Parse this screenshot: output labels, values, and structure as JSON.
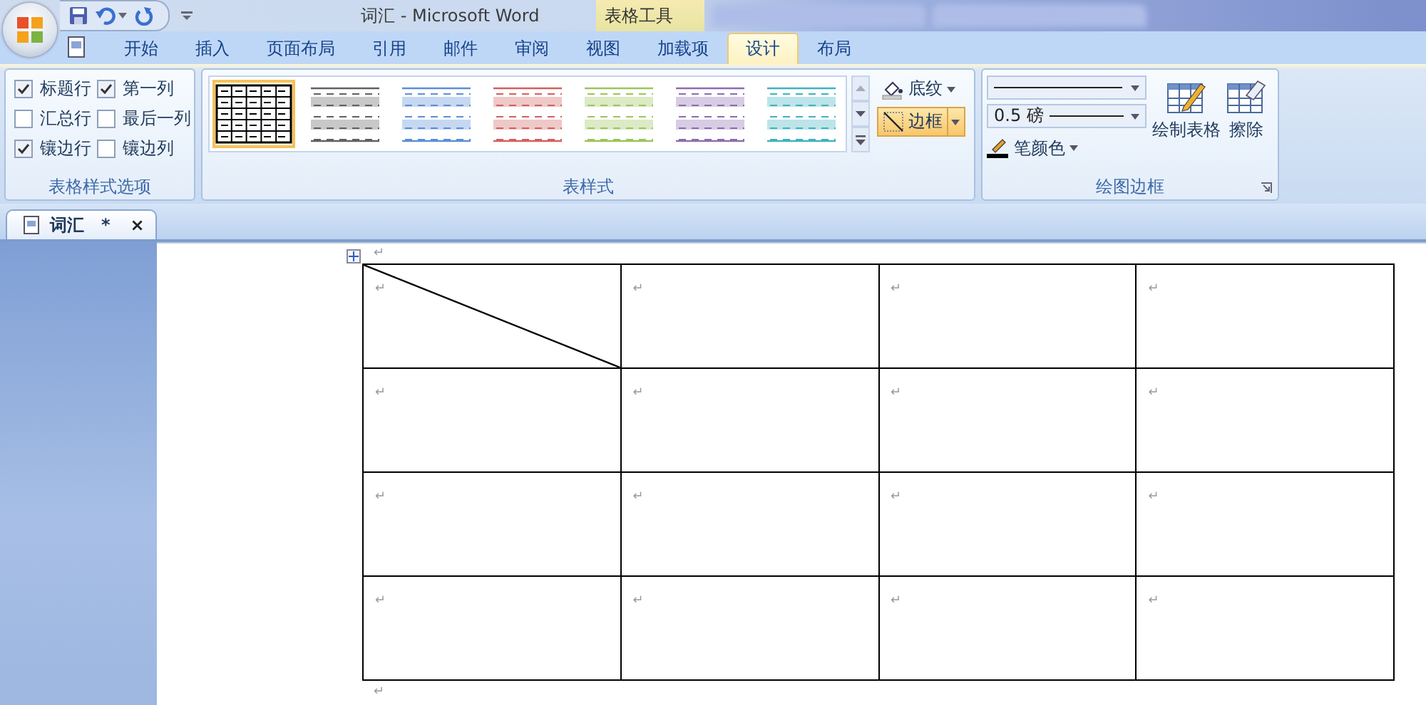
{
  "title_bar": {
    "title": "词汇 - Microsoft Word",
    "context_tab": "表格工具"
  },
  "tabs": [
    {
      "label": "开始",
      "selected": false
    },
    {
      "label": "插入",
      "selected": false
    },
    {
      "label": "页面布局",
      "selected": false
    },
    {
      "label": "引用",
      "selected": false
    },
    {
      "label": "邮件",
      "selected": false
    },
    {
      "label": "审阅",
      "selected": false
    },
    {
      "label": "视图",
      "selected": false
    },
    {
      "label": "加载项",
      "selected": false
    },
    {
      "label": "设计",
      "selected": true
    },
    {
      "label": "布局",
      "selected": false
    }
  ],
  "style_options": {
    "title": "表格样式选项",
    "items": [
      {
        "label": "标题行",
        "checked": true
      },
      {
        "label": "第一列",
        "checked": true
      },
      {
        "label": "汇总行",
        "checked": false
      },
      {
        "label": "最后一列",
        "checked": false
      },
      {
        "label": "镶边行",
        "checked": true
      },
      {
        "label": "镶边列",
        "checked": false
      }
    ]
  },
  "table_styles": {
    "title": "表样式",
    "styles": [
      {
        "kind": "grid",
        "color": "#000000",
        "selected": true
      },
      {
        "kind": "banded",
        "color": "#606060",
        "selected": false
      },
      {
        "kind": "banded",
        "color": "#5b8ed6",
        "selected": false
      },
      {
        "kind": "banded",
        "color": "#d26060",
        "selected": false
      },
      {
        "kind": "banded",
        "color": "#9cc45a",
        "selected": false
      },
      {
        "kind": "banded",
        "color": "#8c6cb0",
        "selected": false
      },
      {
        "kind": "banded",
        "color": "#3fb2c0",
        "selected": false
      }
    ],
    "shading": "底纹",
    "borders": {
      "label": "边框",
      "selected": true
    }
  },
  "draw_borders": {
    "title": "绘图边框",
    "line_weight": "0.5 磅",
    "pen_color": "笔颜色",
    "draw_table": "绘制表格",
    "eraser": "擦除"
  },
  "document_tab": {
    "title": "词汇",
    "modified": "*",
    "close": "×"
  },
  "document": {
    "before": "↵",
    "after": "↵",
    "rows": [
      [
        {
          "text": "↵",
          "diagonal": true
        },
        {
          "text": "↵",
          "diagonal": false
        },
        {
          "text": "↵",
          "diagonal": false
        },
        {
          "text": "↵",
          "diagonal": false
        }
      ],
      [
        {
          "text": "↵",
          "diagonal": false
        },
        {
          "text": "↵",
          "diagonal": false
        },
        {
          "text": "↵",
          "diagonal": false
        },
        {
          "text": "↵",
          "diagonal": false
        }
      ],
      [
        {
          "text": "↵",
          "diagonal": false
        },
        {
          "text": "↵",
          "diagonal": false
        },
        {
          "text": "↵",
          "diagonal": false
        },
        {
          "text": "↵",
          "diagonal": false
        }
      ],
      [
        {
          "text": "↵",
          "diagonal": false
        },
        {
          "text": "↵",
          "diagonal": false
        },
        {
          "text": "↵",
          "diagonal": false
        },
        {
          "text": "↵",
          "diagonal": false
        }
      ]
    ]
  }
}
